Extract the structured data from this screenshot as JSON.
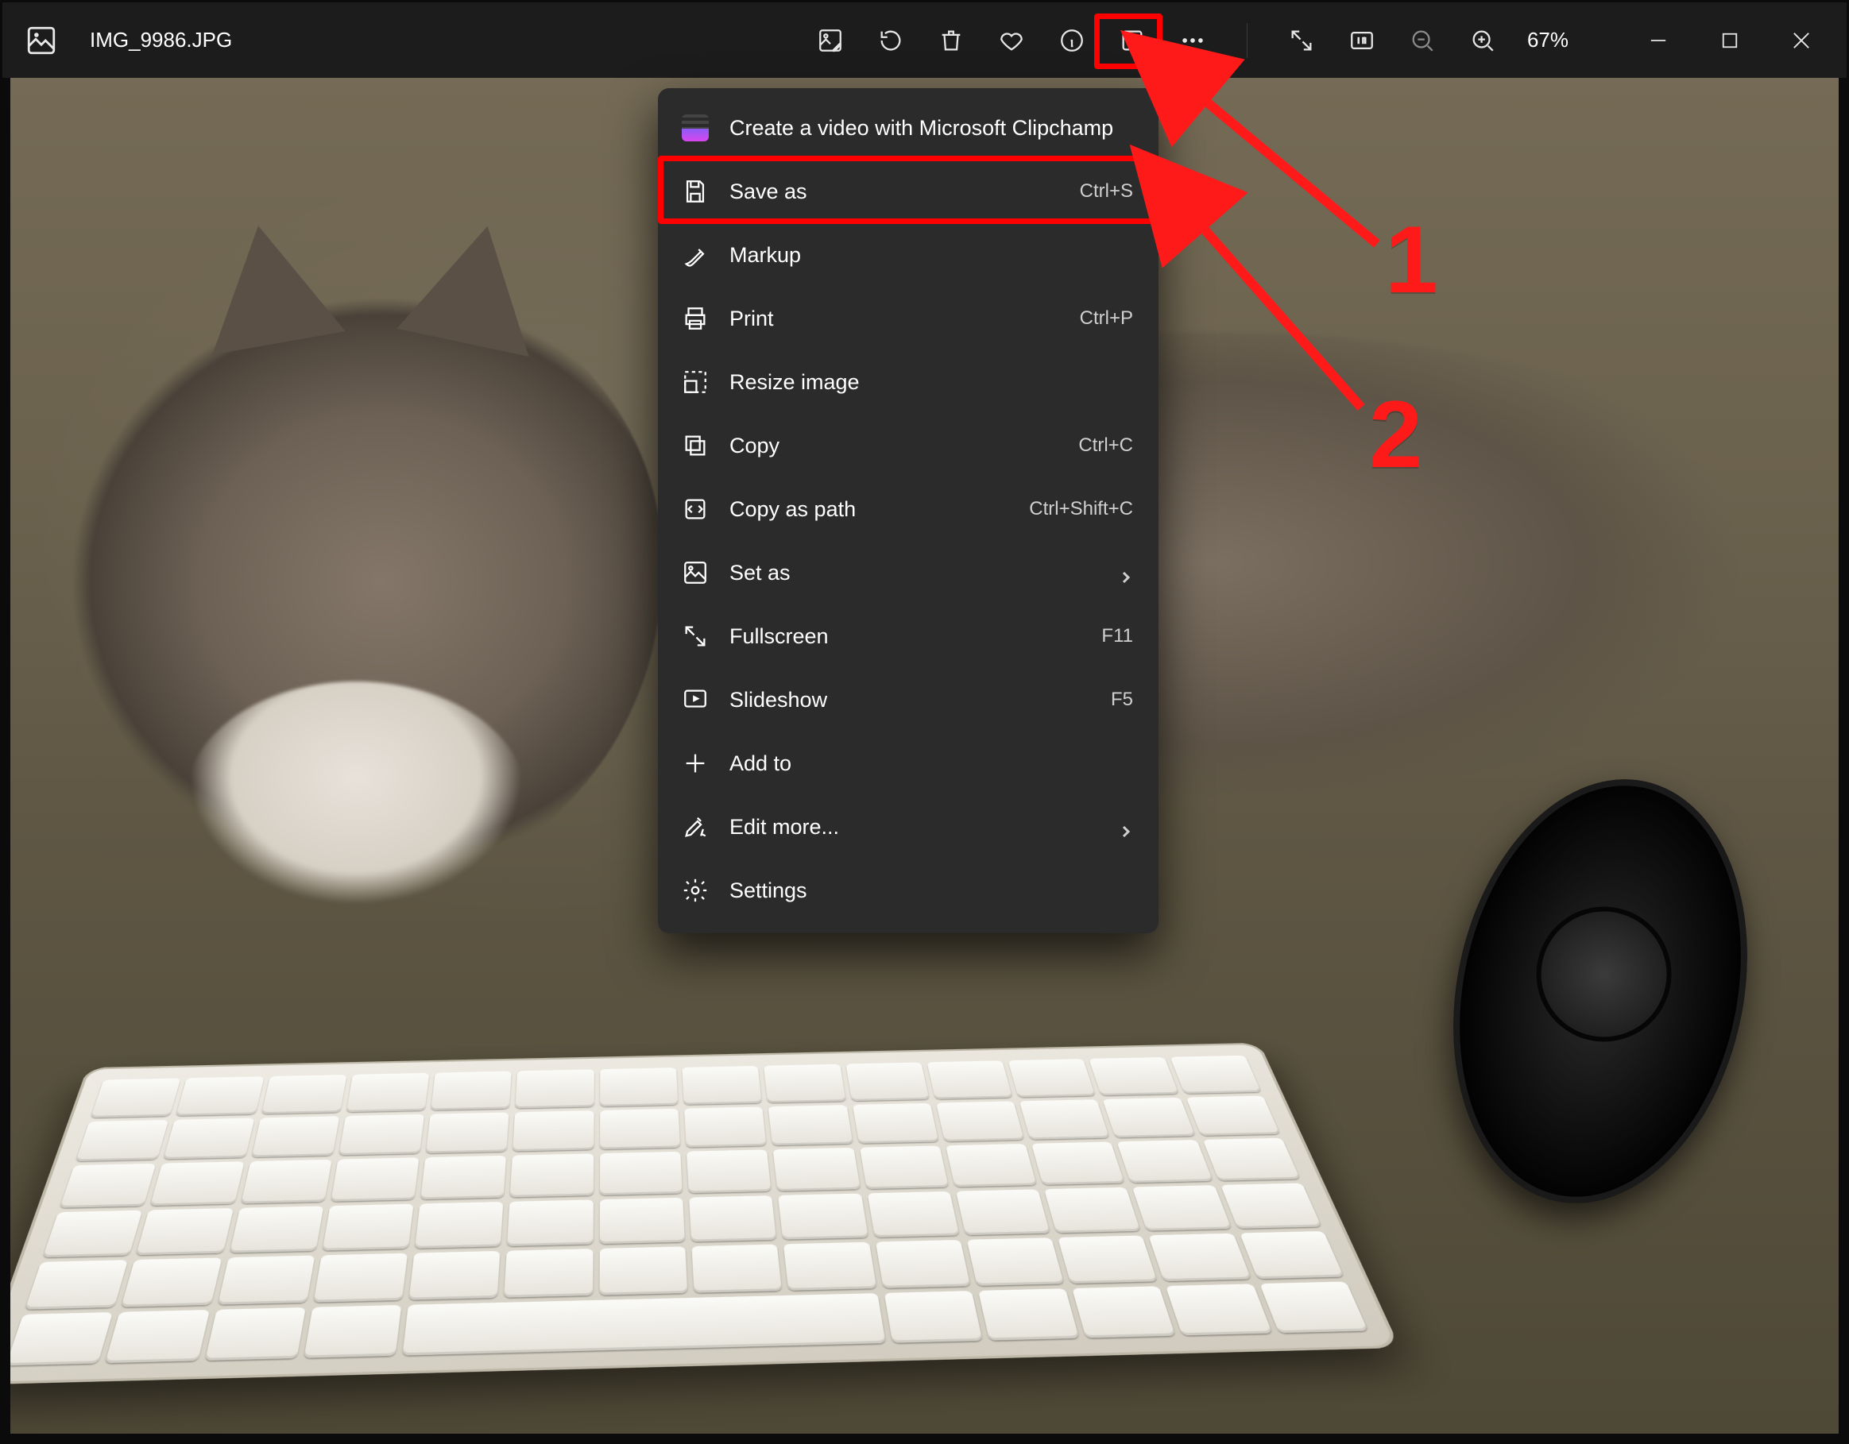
{
  "filename": "IMG_9986.JPG",
  "zoom_label": "67%",
  "menu": {
    "clipchamp": "Create a video with Microsoft Clipchamp",
    "save_as": {
      "label": "Save as",
      "accel": "Ctrl+S"
    },
    "markup": {
      "label": "Markup"
    },
    "print": {
      "label": "Print",
      "accel": "Ctrl+P"
    },
    "resize": {
      "label": "Resize image"
    },
    "copy": {
      "label": "Copy",
      "accel": "Ctrl+C"
    },
    "copypath": {
      "label": "Copy as path",
      "accel": "Ctrl+Shift+C"
    },
    "set_as": {
      "label": "Set as"
    },
    "fullscreen": {
      "label": "Fullscreen",
      "accel": "F11"
    },
    "slideshow": {
      "label": "Slideshow",
      "accel": "F5"
    },
    "add_to": {
      "label": "Add to"
    },
    "edit_more": {
      "label": "Edit more..."
    },
    "settings": {
      "label": "Settings"
    }
  },
  "annotations": {
    "step1": "1",
    "step2": "2"
  }
}
